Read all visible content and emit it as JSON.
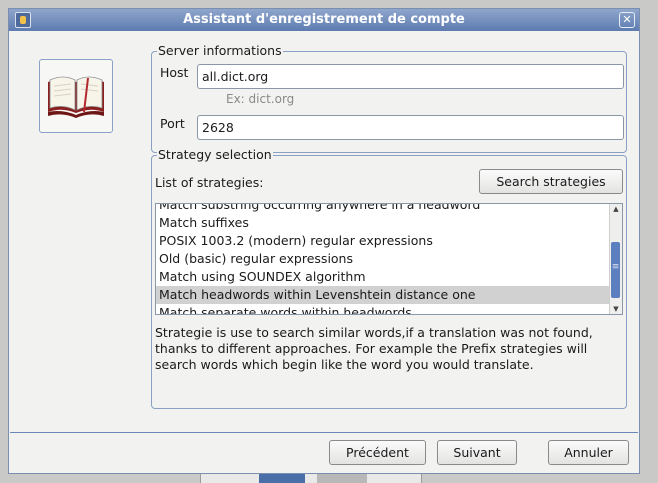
{
  "window": {
    "title": "Assistant d'enregistrement de compte"
  },
  "server": {
    "legend": "Server informations",
    "host_label": "Host",
    "host_value": "all.dict.org",
    "host_hint": "Ex: dict.org",
    "port_label": "Port",
    "port_value": "2628"
  },
  "strategy": {
    "legend": "Strategy selection",
    "list_label": "List of strategies:",
    "search_button": "Search strategies",
    "items": [
      "Match substring occurring anywhere in a headword",
      "Match suffixes",
      "POSIX 1003.2 (modern) regular expressions",
      "Old (basic) regular expressions",
      "Match using SOUNDEX algorithm",
      "Match headwords within Levenshtein distance one",
      "Match separate words within headwords"
    ],
    "selected_index": 5,
    "description": "Strategie is use to search similar words,if a translation was not found, thanks to different approaches. For example the Prefix strategies will search words which begin like the word you would translate."
  },
  "buttons": {
    "previous": "Précédent",
    "next": "Suivant",
    "cancel": "Annuler"
  },
  "icons": {
    "app": "app-icon",
    "close": "close-icon",
    "dictionary": "book-icon"
  },
  "colors": {
    "titlebar": "#6f8bbd",
    "selection": "#d1d1d1",
    "scroll_thumb": "#5c7fc0"
  }
}
